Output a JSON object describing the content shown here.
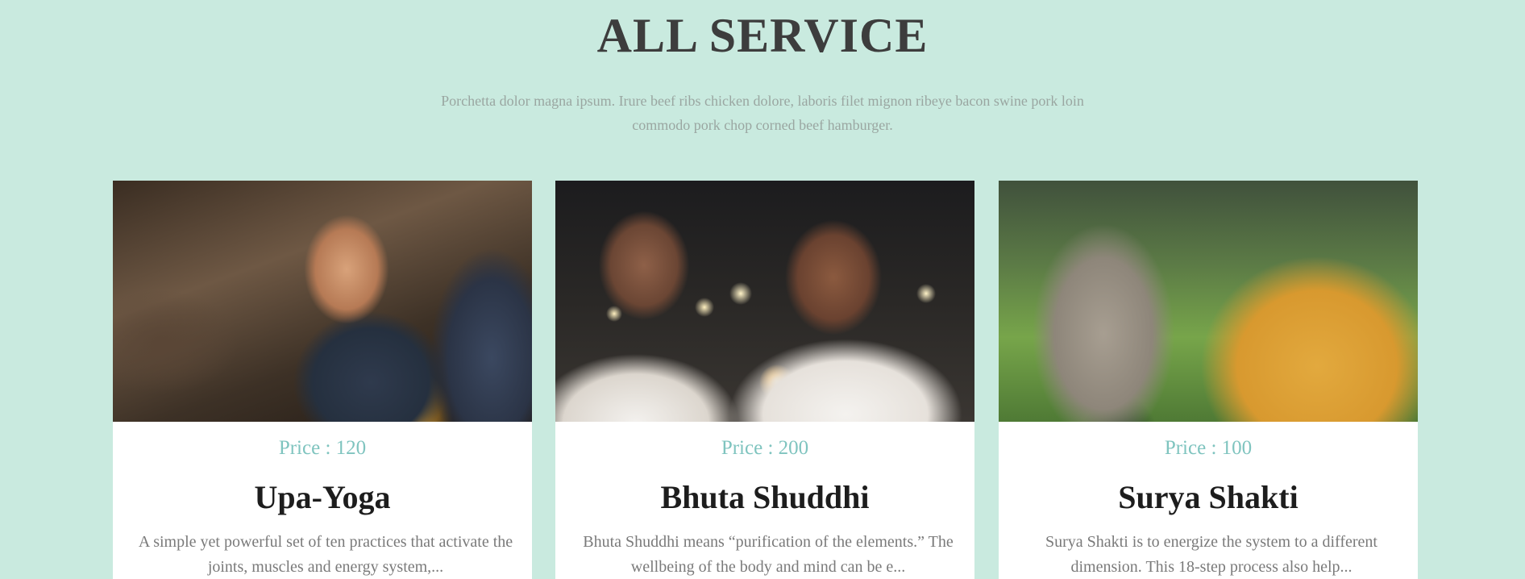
{
  "section": {
    "title": "ALL SERVICE",
    "subtitle": "Porchetta dolor magna ipsum. Irure beef ribs chicken dolore, laboris filet mignon ribeye bacon swine pork loin commodo pork chop corned beef hamburger."
  },
  "cards": [
    {
      "price": "Price : 120",
      "title": "Upa-Yoga",
      "description": "A simple yet powerful set of ten practices that activate the joints, muscles and energy system,...",
      "image": "upa-yoga-photo"
    },
    {
      "price": "Price : 200",
      "title": "Bhuta Shuddhi",
      "description": "Bhuta Shuddhi means “purification of the elements.” The wellbeing of the body and mind can be e...",
      "image": "bhuta-shuddhi-photo"
    },
    {
      "price": "Price : 100",
      "title": "Surya Shakti",
      "description": "Surya Shakti is to energize the system to a different dimension. This 18-step process also help...",
      "image": "surya-shakti-photo"
    }
  ],
  "colors": {
    "background": "#c9eadf",
    "title": "#3d3d3d",
    "subtitle": "#9aa6a1",
    "price": "#7fc4bf",
    "card_title": "#1d1d1d",
    "description": "#7a7a7a",
    "card_background": "#ffffff"
  }
}
